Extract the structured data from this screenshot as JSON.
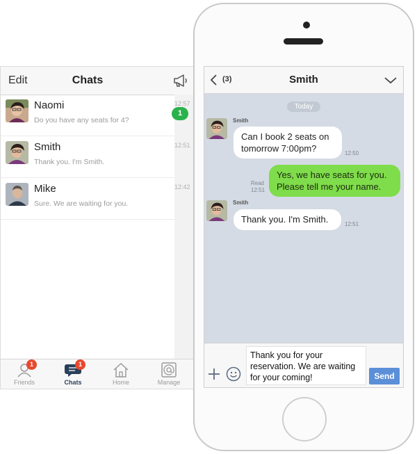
{
  "chat_list": {
    "edit_label": "Edit",
    "title": "Chats",
    "items": [
      {
        "name": "Naomi",
        "preview": "Do you have any seats for 4?",
        "time": "12:57",
        "unread": "1"
      },
      {
        "name": "Smith",
        "preview": "Thank you. I'm Smith.",
        "time": "12:51"
      },
      {
        "name": "Mike",
        "preview": "Sure. We are waiting for you.",
        "time": "12:42"
      }
    ],
    "tabs": [
      {
        "label": "Friends",
        "badge": "1",
        "icon": "person-icon"
      },
      {
        "label": "Chats",
        "badge": "1",
        "icon": "chat-bubble-icon",
        "active": true
      },
      {
        "label": "Home",
        "icon": "home-icon"
      },
      {
        "label": "Manage",
        "icon": "at-sign-icon"
      }
    ]
  },
  "conversation": {
    "back_count": "(3)",
    "title": "Smith",
    "date_label": "Today",
    "messages": [
      {
        "direction": "in",
        "sender": "Smith",
        "text_line1": "Can I book 2 seats on",
        "text_line2": "tomorrow 7:00pm?",
        "time": "12:50"
      },
      {
        "direction": "out",
        "status": "Read",
        "text_line1": "Yes, we have seats for you.",
        "text_line2": "Please tell me your name.",
        "time": "12:51"
      },
      {
        "direction": "in",
        "sender": "Smith",
        "text_line1": "Thank you. I'm Smith.",
        "time": "12:51"
      }
    ],
    "composer": {
      "value": "Thank you for your reservation. We are waiting for your coming!",
      "send_label": "Send"
    }
  },
  "colors": {
    "unread_green": "#2bb24c",
    "badge_red": "#e8482f",
    "outgoing_bubble": "#7fdc4a",
    "chat_background": "#d5dbe4",
    "send_button": "#5b8fd8"
  }
}
